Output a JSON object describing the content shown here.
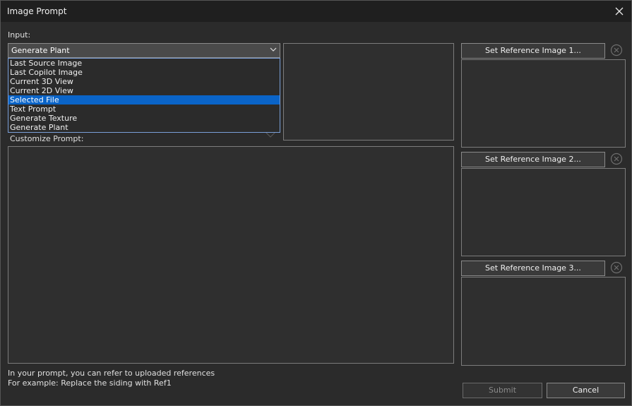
{
  "window": {
    "title": "Image Prompt"
  },
  "input": {
    "label": "Input:",
    "selected": "Generate Plant",
    "options": [
      "Last Source Image",
      "Last Copilot Image",
      "Current 3D View",
      "Current 2D View",
      "Selected File",
      "Text Prompt",
      "Generate Texture",
      "Generate Plant"
    ],
    "highlighted_index": 4
  },
  "prompt": {
    "label": "Customize Prompt:",
    "value": ""
  },
  "references": [
    {
      "button_label": "Set Reference Image 1..."
    },
    {
      "button_label": "Set Reference Image 2..."
    },
    {
      "button_label": "Set Reference Image 3..."
    }
  ],
  "hint": {
    "line1": "In your prompt, you can refer to uploaded references",
    "line2": "For example: Replace the siding with Ref1"
  },
  "actions": {
    "submit_label": "Submit",
    "cancel_label": "Cancel"
  },
  "icons": {
    "close": "close-icon",
    "dropdown": "chevron-down-icon",
    "clear": "clear-circle-icon"
  }
}
